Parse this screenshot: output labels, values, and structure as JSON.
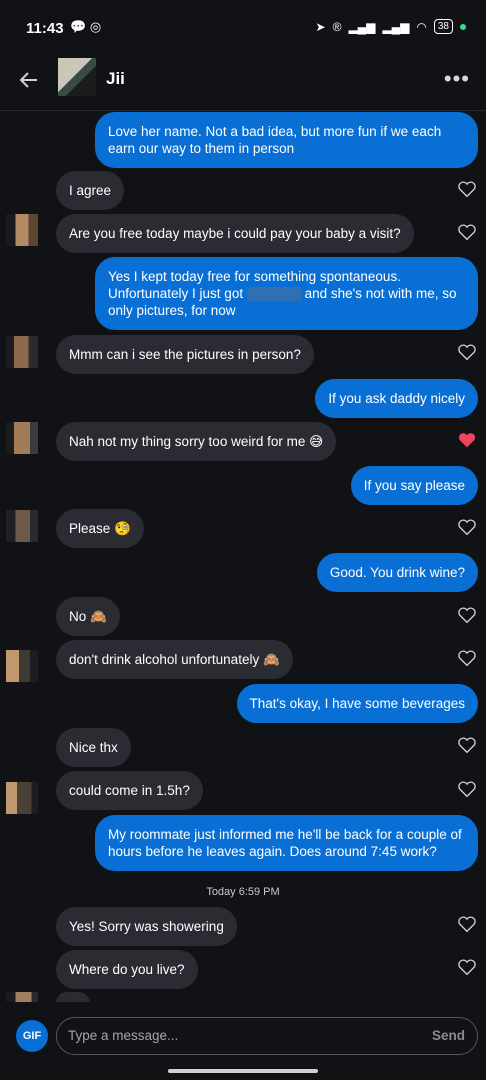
{
  "status_bar": {
    "time": "11:43",
    "battery": "38"
  },
  "header": {
    "contact_name": "Jii"
  },
  "messages": [
    {
      "dir": "out",
      "text": "Love her name. Not a bad idea, but more fun if we each earn our way to them in person"
    },
    {
      "dir": "in",
      "text": "I agree"
    },
    {
      "dir": "in",
      "text": "Are you free today maybe i could pay your baby a visit?"
    },
    {
      "dir": "out",
      "text": "Yes I kept today free for something spontaneous. Unfortunately I just got"
    },
    {
      "dir": "out",
      "text": "and she's not with me, so only pictures, for now"
    },
    {
      "dir": "in",
      "text": "Mmm can i see the pictures in person?"
    },
    {
      "dir": "out",
      "text": "If you ask daddy nicely"
    },
    {
      "dir": "in",
      "text": "Nah not my thing sorry too weird for me 😅"
    },
    {
      "dir": "out",
      "text": "If you say please"
    },
    {
      "dir": "in",
      "text": "Please 🧐"
    },
    {
      "dir": "out",
      "text": "Good. You drink wine?"
    },
    {
      "dir": "in",
      "text": "No 🙈"
    },
    {
      "dir": "in",
      "text": "don't drink alcohol unfortunately 🙈"
    },
    {
      "dir": "out",
      "text": "That's okay, I have some beverages"
    },
    {
      "dir": "in",
      "text": "Nice thx"
    },
    {
      "dir": "in",
      "text": "could come in 1.5h?"
    },
    {
      "dir": "out",
      "text": "My roommate just informed me he'll be back for a couple of hours before he leaves again. Does around 7:45 work?"
    },
    {
      "dir": "in",
      "text": "Yes! Sorry was showering"
    },
    {
      "dir": "in",
      "text": "Where do you live?"
    }
  ],
  "timestamp": "Today 6:59 PM",
  "composer": {
    "gif_label": "GIF",
    "placeholder": "Type a message...",
    "send_label": "Send"
  },
  "colors": {
    "outgoing": "#0a6fd4",
    "incoming": "#2b2c33",
    "liked_heart": "#f0435c"
  }
}
